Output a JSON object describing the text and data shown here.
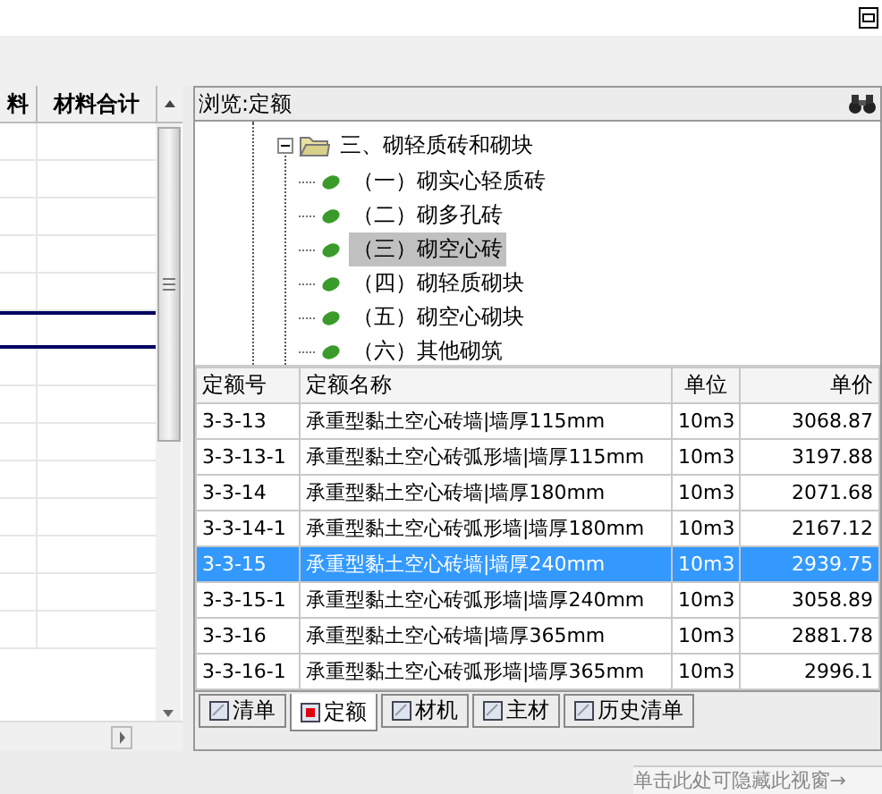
{
  "left_grid": {
    "columns": [
      "料",
      "材料合计"
    ],
    "rows": [
      {
        "selected": false
      },
      {
        "selected": false
      },
      {
        "selected": false
      },
      {
        "selected": false
      },
      {
        "selected": false
      },
      {
        "selected": true
      },
      {
        "selected": false
      },
      {
        "selected": false
      },
      {
        "selected": false
      },
      {
        "selected": false
      },
      {
        "selected": false
      },
      {
        "selected": false
      },
      {
        "selected": false
      },
      {
        "selected": false
      }
    ]
  },
  "browser": {
    "title": "浏览:定额",
    "tree": {
      "label": "三、砌轻质砖和砌块",
      "expanded": true,
      "children": [
        {
          "label": "（一）砌实心轻质砖",
          "selected": false
        },
        {
          "label": "（二）砌多孔砖",
          "selected": false
        },
        {
          "label": "（三）砌空心砖",
          "selected": true
        },
        {
          "label": "（四）砌轻质砌块",
          "selected": false
        },
        {
          "label": "（五）砌空心砌块",
          "selected": false
        },
        {
          "label": "（六）其他砌筑",
          "selected": false
        }
      ]
    },
    "table": {
      "columns": [
        "定额号",
        "定额名称",
        "单位",
        "单价"
      ],
      "rows": [
        {
          "cells": [
            "3-3-13",
            "承重型黏土空心砖墙|墙厚115mm",
            "10m3",
            "3068.87"
          ],
          "selected": false
        },
        {
          "cells": [
            "3-3-13-1",
            "承重型黏土空心砖弧形墙|墙厚115mm",
            "10m3",
            "3197.88"
          ],
          "selected": false
        },
        {
          "cells": [
            "3-3-14",
            "承重型黏土空心砖墙|墙厚180mm",
            "10m3",
            "2071.68"
          ],
          "selected": false
        },
        {
          "cells": [
            "3-3-14-1",
            "承重型黏土空心砖弧形墙|墙厚180mm",
            "10m3",
            "2167.12"
          ],
          "selected": false
        },
        {
          "cells": [
            "3-3-15",
            "承重型黏土空心砖墙|墙厚240mm",
            "10m3",
            "2939.75"
          ],
          "selected": true
        },
        {
          "cells": [
            "3-3-15-1",
            "承重型黏土空心砖弧形墙|墙厚240mm",
            "10m3",
            "3058.89"
          ],
          "selected": false
        },
        {
          "cells": [
            "3-3-16",
            "承重型黏土空心砖墙|墙厚365mm",
            "10m3",
            "2881.78"
          ],
          "selected": false
        },
        {
          "cells": [
            "3-3-16-1",
            "承重型黏土空心砖弧形墙|墙厚365mm",
            "10m3",
            "2996.1"
          ],
          "selected": false
        }
      ]
    },
    "tabs": [
      {
        "label": "清单",
        "selected": false
      },
      {
        "label": "定额",
        "selected": true
      },
      {
        "label": "材机",
        "selected": false
      },
      {
        "label": "主材",
        "selected": false
      },
      {
        "label": "历史清单",
        "selected": false
      }
    ]
  },
  "hint": "单击此处可隐藏此视窗→"
}
